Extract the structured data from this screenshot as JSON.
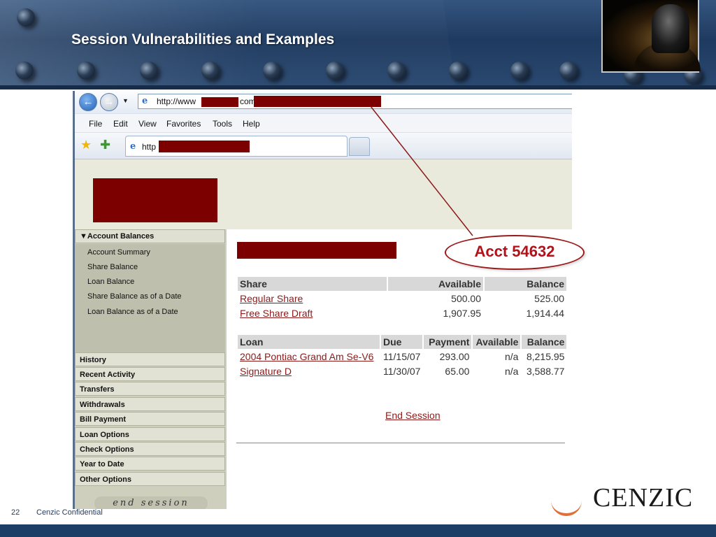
{
  "slide": {
    "title": "Session Vulnerabilities and Examples",
    "page_number": "22",
    "footer": "Cenzic Confidential",
    "brand": "CENZIC"
  },
  "browser": {
    "address_prefix": "http://www",
    "address_mid": "com",
    "tab_text": "http",
    "menu": [
      "File",
      "Edit",
      "View",
      "Favorites",
      "Tools",
      "Help"
    ]
  },
  "sidebar": {
    "section_title": "Account Balances",
    "sub_items": [
      "Account Summary",
      "Share Balance",
      "Loan Balance",
      "Share Balance as of a Date",
      "Loan Balance as of a Date"
    ],
    "items": [
      "History",
      "Recent Activity",
      "Transfers",
      "Withdrawals",
      "Bill Payment",
      "Loan Options",
      "Check Options",
      "Year to Date",
      "Other Options"
    ],
    "end_session": "end session"
  },
  "share_table": {
    "headers": [
      "Share",
      "Available",
      "Balance"
    ],
    "rows": [
      {
        "name": "Regular Share",
        "available": "500.00",
        "balance": "525.00"
      },
      {
        "name": "Free Share Draft",
        "available": "1,907.95",
        "balance": "1,914.44"
      }
    ]
  },
  "loan_table": {
    "headers": [
      "Loan",
      "Due",
      "Payment",
      "Available",
      "Balance"
    ],
    "rows": [
      {
        "name": "2004 Pontiac Grand Am Se-V6",
        "due": "11/15/07",
        "payment": "293.00",
        "available": "n/a",
        "balance": "8,215.95"
      },
      {
        "name": "Signature D",
        "due": "11/30/07",
        "payment": "65.00",
        "available": "n/a",
        "balance": "3,588.77"
      }
    ]
  },
  "end_session_link": "End Session",
  "callout": "Acct 54632",
  "colors": {
    "redaction": "#7d0000",
    "callout_red": "#b3121b",
    "link_red": "#8b1a1a",
    "banner_blue": "#1f3a5f"
  }
}
